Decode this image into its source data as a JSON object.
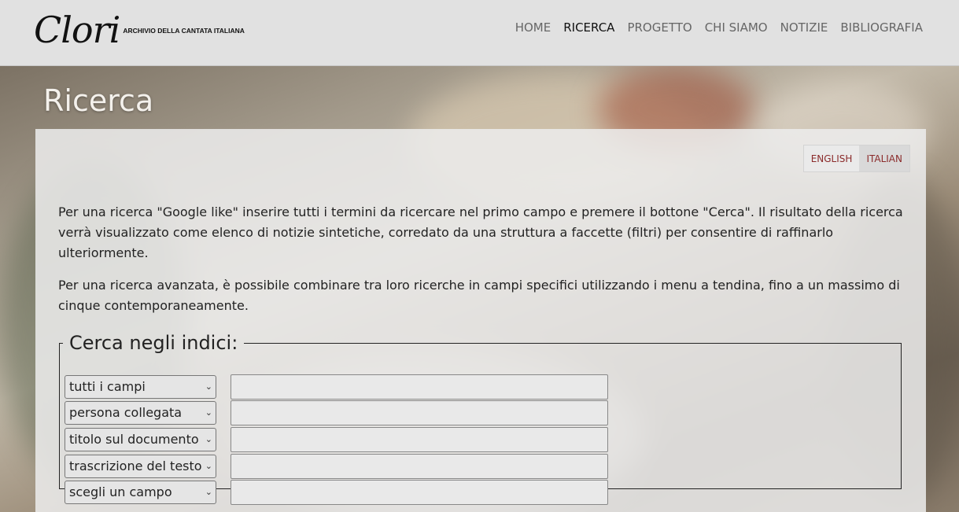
{
  "header": {
    "logo_mark": "Clori",
    "logo_subtitle": "ARCHIVIO DELLA CANTATA ITALIANA",
    "nav": [
      "HOME",
      "RICERCA",
      "PROGETTO",
      "CHI SIAMO",
      "NOTIZIE",
      "BIBLIOGRAFIA"
    ],
    "active_nav": "RICERCA"
  },
  "page": {
    "title": "Ricerca"
  },
  "language": {
    "english": "ENGLISH",
    "italian": "ITALIAN",
    "selected": "ITALIAN"
  },
  "intro": {
    "p1": "Per una ricerca \"Google like\" inserire tutti i termini da ricercare nel primo campo e premere il bottone \"Cerca\".  Il risultato della ricerca verrà visualizzato come elenco di notizie sintetiche, corredato da una struttura a faccette (filtri) per consentire di raffinarlo ulteriormente.",
    "p2": "Per una ricerca avanzata, è possibile combinare tra loro ricerche in campi specifici utilizzando i menu a tendina, fino a un massimo di cinque contemporaneamente."
  },
  "search": {
    "legend": "Cerca negli indici:",
    "rows": [
      {
        "field": "tutti i campi",
        "value": ""
      },
      {
        "field": "persona collegata",
        "value": ""
      },
      {
        "field": "titolo sul documento",
        "value": ""
      },
      {
        "field": "trascrizione del testo",
        "value": ""
      },
      {
        "field": "scegli un campo",
        "value": ""
      }
    ]
  },
  "colors": {
    "header_bg": "#e1e1e1",
    "accent_lang": "#8b2b2b",
    "title_text": "#f4f1ec"
  },
  "icons": {
    "select_arrow": "chevron-down-icon"
  }
}
